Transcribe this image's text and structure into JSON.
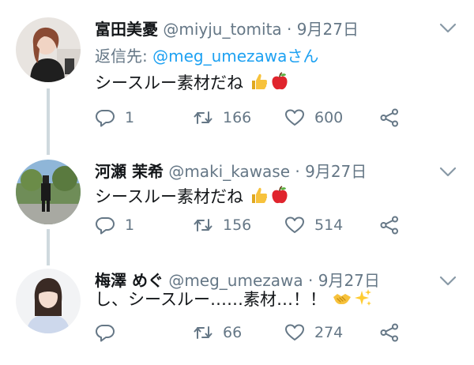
{
  "tweets": [
    {
      "name": "富田美憂",
      "handle": "@miyju_tomita",
      "dot": "·",
      "date": "9月27日",
      "reply_prefix": "返信先: ",
      "reply_mention": "@meg_umezawaさん",
      "text": "シースルー素材だね",
      "emojis": [
        "thumbs-up",
        "red-apple"
      ],
      "reply_count": "1",
      "retweet_count": "166",
      "like_count": "600"
    },
    {
      "name": "河瀬 茉希",
      "handle": "@maki_kawase",
      "dot": "·",
      "date": "9月27日",
      "text": "シースルー素材だね",
      "emojis": [
        "thumbs-up",
        "red-apple"
      ],
      "reply_count": "1",
      "retweet_count": "156",
      "like_count": "514"
    },
    {
      "name": "梅澤 めぐ",
      "handle": "@meg_umezawa",
      "dot": "·",
      "date": "9月27日",
      "text": "し、シースルー……素材…！！",
      "emojis": [
        "handshake",
        "sparkles"
      ],
      "reply_count": "",
      "retweet_count": "66",
      "like_count": "274"
    }
  ],
  "colors": {
    "text": "#14171a",
    "secondary": "#657786",
    "link": "#1da1f2",
    "thread_line": "#cfd9de"
  }
}
